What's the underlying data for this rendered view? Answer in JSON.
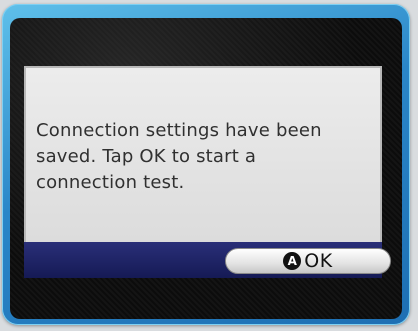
{
  "dialog": {
    "message": "Connection settings have been\nsaved. Tap OK to start a\nconnection test."
  },
  "ok_button": {
    "icon_letter": "A",
    "label": "OK"
  },
  "colors": {
    "frame": "#2a86c8",
    "bottom_bar": "#1f246a",
    "dialog_bg": "#e6e6e6"
  }
}
